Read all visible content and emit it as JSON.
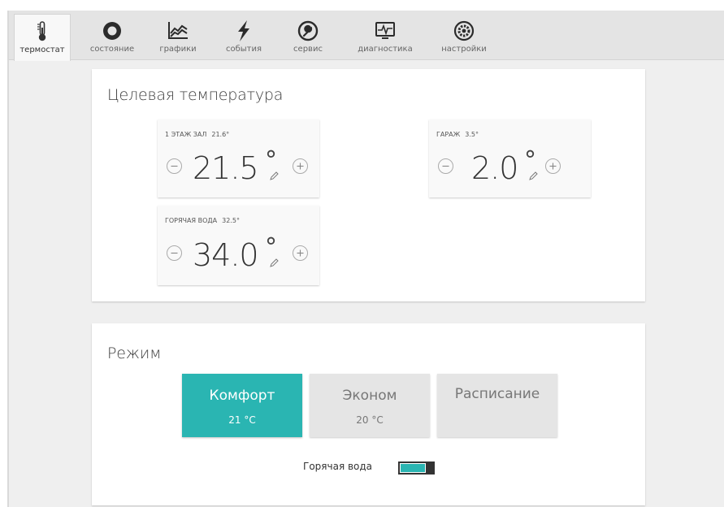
{
  "tabs": [
    {
      "label": "термостат",
      "icon": "thermometer-icon",
      "active": true
    },
    {
      "label": "состояние",
      "icon": "circle-status-icon"
    },
    {
      "label": "графики",
      "icon": "chart-icon"
    },
    {
      "label": "события",
      "icon": "lightning-icon"
    },
    {
      "label": "сервис",
      "icon": "wrench-icon"
    },
    {
      "label": "диагностика",
      "icon": "monitor-pulse-icon"
    },
    {
      "label": "настройки",
      "icon": "gear-icon"
    }
  ],
  "target": {
    "title": "Целевая температура",
    "zones": [
      {
        "name": "1 ЭТАЖ ЗАЛ",
        "current": "21.6°",
        "setpoint": "21.5"
      },
      {
        "name": "ГАРАЖ",
        "current": "3.5°",
        "setpoint": "2.0"
      },
      {
        "name": "ГОРЯЧАЯ ВОДА",
        "current": "32.5°",
        "setpoint": "34.0"
      }
    ],
    "degree_symbol": "°"
  },
  "mode": {
    "title": "Режим",
    "buttons": [
      {
        "name": "Комфорт",
        "temp": "21 °C",
        "active": true
      },
      {
        "name": "Эконом",
        "temp": "20 °C"
      },
      {
        "name": "Расписание",
        "temp": ""
      }
    ],
    "hot_water_label": "Горячая вода",
    "hot_water_on": true
  },
  "colors": {
    "accent": "#2ab5b2",
    "inactive_button": "#e5e5e5",
    "background": "#efefef"
  }
}
